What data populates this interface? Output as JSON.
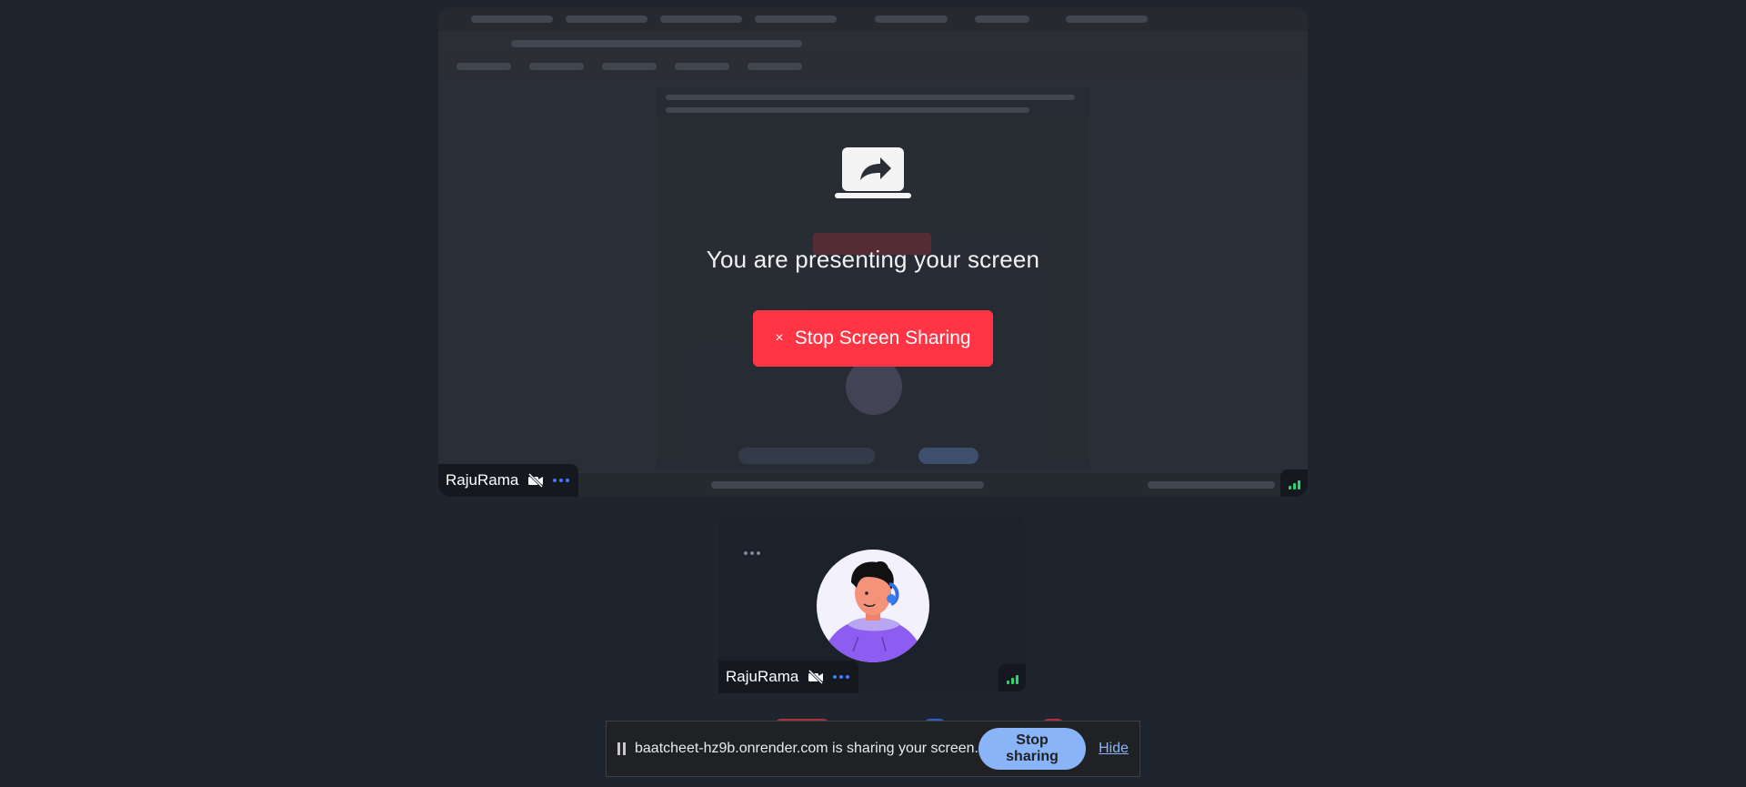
{
  "presenting": {
    "message": "You are presenting your screen",
    "stop_button": "Stop Screen Sharing",
    "stop_icon": "×",
    "presenter_name": "RajuRama"
  },
  "participant": {
    "name": "RajuRama"
  },
  "share_bar": {
    "message": "baatcheet-hz9b.onrender.com is sharing your screen.",
    "stop_label": "Stop sharing",
    "hide_label": "Hide"
  },
  "colors": {
    "accent_red": "#ff3444",
    "accent_blue": "#3d7dff",
    "signal_green": "#2bd473",
    "chrome_blue": "#8ab4f8"
  },
  "icons": [
    "present-screen-icon",
    "camera-off-icon",
    "more-options-icon",
    "signal-icon",
    "pause-icon",
    "close-icon"
  ]
}
